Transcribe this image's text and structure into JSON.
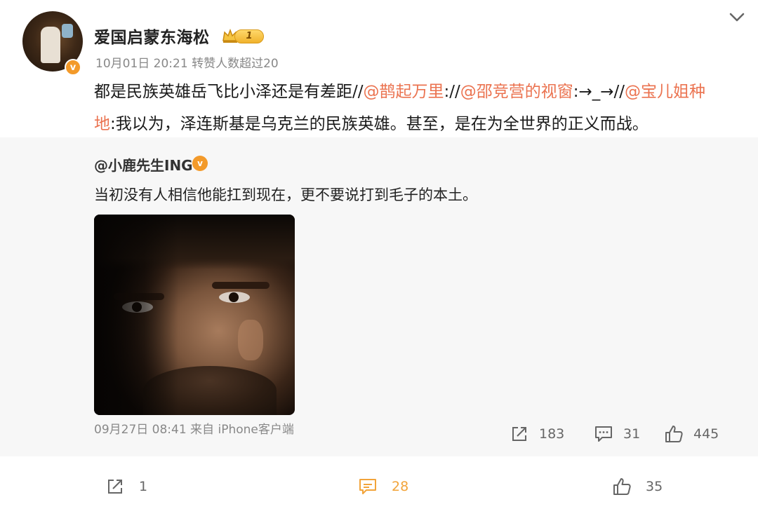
{
  "post": {
    "author": "爱国启蒙东海松",
    "vip_level": "1",
    "timestamp": "10月01日 20:21",
    "repost_note": "转赞人数超过20",
    "text_prefix": "都是民族英雄岳飞比小泽还是有差距//",
    "mention_1": "@鹊起万里",
    "sep_1": "://",
    "mention_2": "@邵竞营的视窗",
    "sep_2": ":→_→//",
    "mention_3a": "@宝儿姐种",
    "mention_3b": "地",
    "text_suffix": ":我以为，泽连斯基是乌克兰的民族英雄。甚至，是在为全世界的正义而战。"
  },
  "repost": {
    "author": "@小鹿先生ING",
    "text": "当初没有人相信他能扛到现在，更不要说打到毛子的本土。",
    "meta": "09月27日 08:41 来自 iPhone客户端",
    "share_count": "183",
    "comment_count": "31",
    "like_count": "445"
  },
  "actions": {
    "share_count": "1",
    "comment_count": "28",
    "like_count": "35"
  },
  "colors": {
    "mention": "#eb7350",
    "active_action": "#f2a43a",
    "verified_badge": "#f39a2a"
  },
  "icons": [
    "chevron-down-icon",
    "crown-icon",
    "verified-icon",
    "share-icon",
    "comment-icon",
    "like-icon"
  ]
}
